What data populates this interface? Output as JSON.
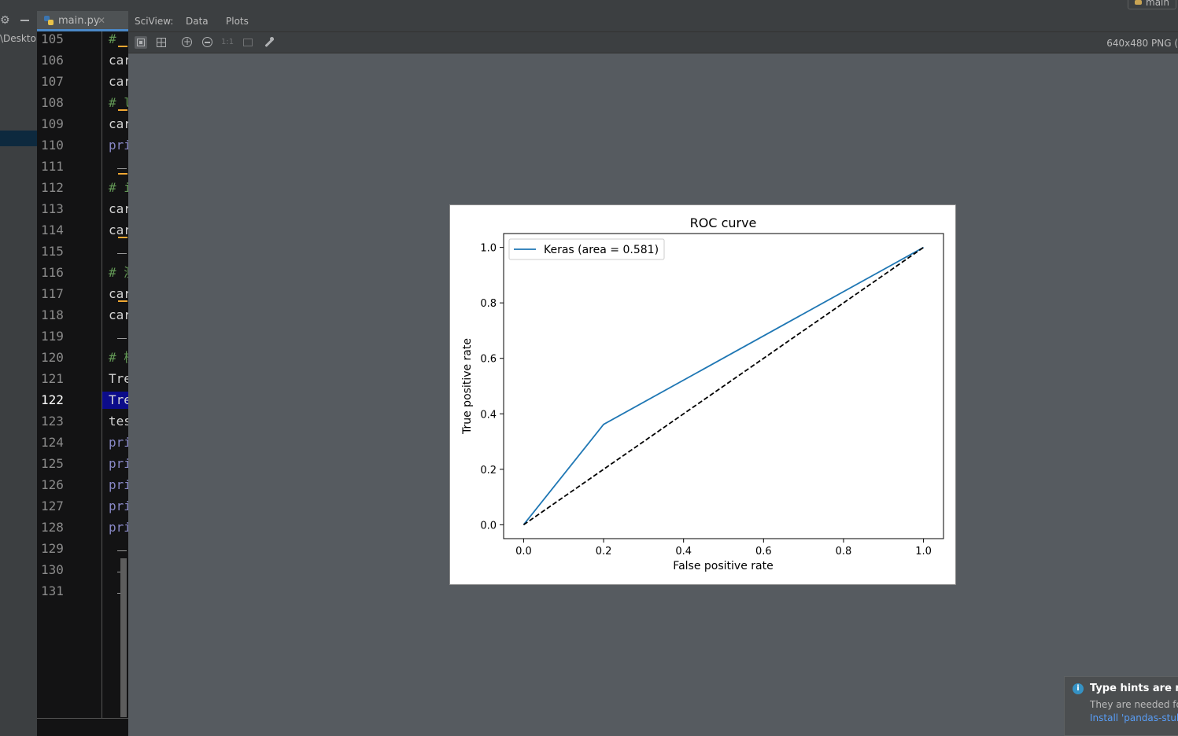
{
  "window": {
    "branch": "main"
  },
  "project": {
    "path": "\\Deskto"
  },
  "editor": {
    "tab": "main.py",
    "line_numbers": [
      "105",
      "106",
      "107",
      "108",
      "109",
      "110",
      "111",
      "112",
      "113",
      "114",
      "115",
      "116",
      "117",
      "118",
      "119",
      "120",
      "121",
      "122",
      "123",
      "124",
      "125",
      "126",
      "127",
      "128",
      "129",
      "130",
      "131"
    ],
    "selected_line": "122",
    "code_lines": [
      {
        "line": "105",
        "text": "#",
        "kind": "comment"
      },
      {
        "line": "106",
        "text": "car",
        "kind": "ident"
      },
      {
        "line": "107",
        "text": "car",
        "kind": "ident"
      },
      {
        "line": "108",
        "text": "# l",
        "kind": "comment"
      },
      {
        "line": "109",
        "text": "car",
        "kind": "ident"
      },
      {
        "line": "110",
        "text": "pri",
        "kind": "builtin"
      },
      {
        "line": "112",
        "text": "# i",
        "kind": "comment"
      },
      {
        "line": "113",
        "text": "car",
        "kind": "ident"
      },
      {
        "line": "114",
        "text": "car",
        "kind": "ident"
      },
      {
        "line": "116",
        "text": "# 测",
        "kind": "comment"
      },
      {
        "line": "117",
        "text": "car",
        "kind": "ident"
      },
      {
        "line": "118",
        "text": "car",
        "kind": "ident"
      },
      {
        "line": "120",
        "text": "# 模",
        "kind": "comment"
      },
      {
        "line": "121",
        "text": "Tre",
        "kind": "ident"
      },
      {
        "line": "122",
        "text": "Tre",
        "kind": "ident"
      },
      {
        "line": "123",
        "text": "tes",
        "kind": "ident"
      },
      {
        "line": "124",
        "text": "pri",
        "kind": "builtin"
      },
      {
        "line": "125",
        "text": "pri",
        "kind": "builtin"
      },
      {
        "line": "126",
        "text": "pri",
        "kind": "builtin"
      },
      {
        "line": "127",
        "text": "pri",
        "kind": "builtin"
      },
      {
        "line": "128",
        "text": "pri",
        "kind": "builtin"
      }
    ],
    "colors": {
      "comment": "#629755",
      "ident": "#d4d4d4",
      "builtin": "#8888c6",
      "selection": "#0c0c8a"
    }
  },
  "sciview": {
    "title": "SciView:",
    "tabs": [
      "Data",
      "Plots"
    ],
    "image_info": "640x480 PNG (",
    "toolbar": [
      {
        "name": "fit-icon",
        "active": true
      },
      {
        "name": "grid-icon",
        "active": false
      },
      {
        "name": "zoom-in-icon",
        "active": false
      },
      {
        "name": "zoom-out-icon",
        "active": false
      },
      {
        "name": "actual-size-icon",
        "label": "1:1",
        "active": false
      },
      {
        "name": "frame-icon",
        "active": false
      },
      {
        "name": "color-picker-icon",
        "active": false
      }
    ]
  },
  "chart_data": {
    "type": "line",
    "title": "ROC curve",
    "xlabel": "False positive rate",
    "ylabel": "True positive rate",
    "xlim": [
      -0.05,
      1.05
    ],
    "ylim": [
      -0.05,
      1.05
    ],
    "xticks": [
      "0.0",
      "0.2",
      "0.4",
      "0.6",
      "0.8",
      "1.0"
    ],
    "yticks": [
      "0.0",
      "0.2",
      "0.4",
      "0.6",
      "0.8",
      "1.0"
    ],
    "grid": false,
    "legend_position": "top-left",
    "series": [
      {
        "name": "Keras (area = 0.581)",
        "x": [
          0.0,
          0.2,
          1.0
        ],
        "y": [
          0.0,
          0.362,
          1.0
        ],
        "color": "#1f77b4",
        "style": "solid"
      },
      {
        "x": [
          0.0,
          1.0
        ],
        "y": [
          0.0,
          1.0
        ],
        "color": "#000000",
        "style": "dashed"
      }
    ]
  },
  "notification": {
    "title": "Type hints are not",
    "body": "They are needed fo",
    "link": "Install 'pandas-stub"
  }
}
